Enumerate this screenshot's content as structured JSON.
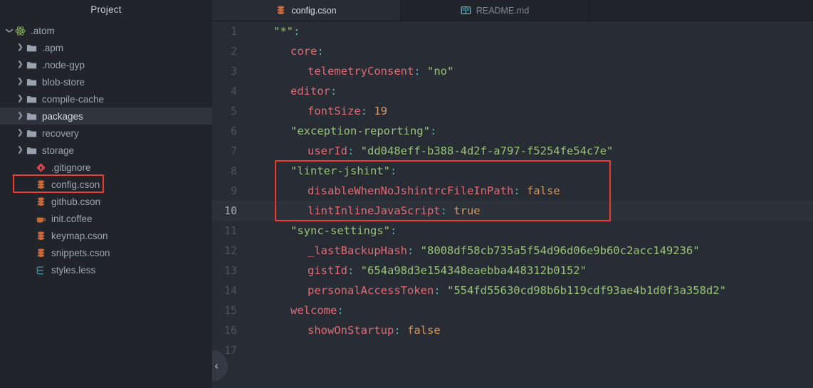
{
  "sidebar": {
    "title": "Project",
    "items": [
      {
        "label": ".atom",
        "icon": "atom-logo-icon",
        "depth": 0,
        "twisty": "open",
        "selected": false,
        "annotated": false
      },
      {
        "label": ".apm",
        "icon": "folder-icon",
        "depth": 1,
        "twisty": "closed",
        "selected": false,
        "annotated": false
      },
      {
        "label": ".node-gyp",
        "icon": "folder-icon",
        "depth": 1,
        "twisty": "closed",
        "selected": false,
        "annotated": false
      },
      {
        "label": "blob-store",
        "icon": "folder-icon",
        "depth": 1,
        "twisty": "closed",
        "selected": false,
        "annotated": false
      },
      {
        "label": "compile-cache",
        "icon": "folder-icon",
        "depth": 1,
        "twisty": "closed",
        "selected": false,
        "annotated": false
      },
      {
        "label": "packages",
        "icon": "folder-icon",
        "depth": 1,
        "twisty": "closed",
        "selected": true,
        "annotated": false
      },
      {
        "label": "recovery",
        "icon": "folder-icon",
        "depth": 1,
        "twisty": "closed",
        "selected": false,
        "annotated": false
      },
      {
        "label": "storage",
        "icon": "folder-icon",
        "depth": 1,
        "twisty": "closed",
        "selected": false,
        "annotated": false
      },
      {
        "label": ".gitignore",
        "icon": "git-diamond-icon",
        "depth": 2,
        "twisty": "none",
        "selected": false,
        "annotated": false
      },
      {
        "label": "config.cson",
        "icon": "database-icon",
        "depth": 2,
        "twisty": "none",
        "selected": false,
        "annotated": true
      },
      {
        "label": "github.cson",
        "icon": "database-icon",
        "depth": 2,
        "twisty": "none",
        "selected": false,
        "annotated": false
      },
      {
        "label": "init.coffee",
        "icon": "coffee-cup-icon",
        "depth": 2,
        "twisty": "none",
        "selected": false,
        "annotated": false
      },
      {
        "label": "keymap.cson",
        "icon": "database-icon",
        "depth": 2,
        "twisty": "none",
        "selected": false,
        "annotated": false
      },
      {
        "label": "snippets.cson",
        "icon": "database-icon",
        "depth": 2,
        "twisty": "none",
        "selected": false,
        "annotated": false
      },
      {
        "label": "styles.less",
        "icon": "less-file-icon",
        "depth": 2,
        "twisty": "none",
        "selected": false,
        "annotated": false
      }
    ]
  },
  "tabs": [
    {
      "label": "config.cson",
      "icon": "database-icon",
      "active": true
    },
    {
      "label": "README.md",
      "icon": "book-icon",
      "active": false
    }
  ],
  "editor": {
    "filename": "config.cson",
    "cursor_line": 10,
    "lines": [
      {
        "num": "1",
        "indent": 0,
        "tokens": [
          {
            "t": "\"*\"",
            "c": "s"
          },
          {
            "t": ":",
            "c": "p"
          }
        ]
      },
      {
        "num": "2",
        "indent": 1,
        "tokens": [
          {
            "t": "core",
            "c": "k"
          },
          {
            "t": ":",
            "c": "p"
          }
        ]
      },
      {
        "num": "3",
        "indent": 2,
        "tokens": [
          {
            "t": "telemetryConsent",
            "c": "k"
          },
          {
            "t": ": ",
            "c": "p"
          },
          {
            "t": "\"no\"",
            "c": "s"
          }
        ]
      },
      {
        "num": "4",
        "indent": 1,
        "tokens": [
          {
            "t": "editor",
            "c": "k"
          },
          {
            "t": ":",
            "c": "p"
          }
        ]
      },
      {
        "num": "5",
        "indent": 2,
        "tokens": [
          {
            "t": "fontSize",
            "c": "k"
          },
          {
            "t": ": ",
            "c": "p"
          },
          {
            "t": "19",
            "c": "n"
          }
        ]
      },
      {
        "num": "6",
        "indent": 1,
        "tokens": [
          {
            "t": "\"exception-reporting\"",
            "c": "s"
          },
          {
            "t": ":",
            "c": "p"
          }
        ]
      },
      {
        "num": "7",
        "indent": 2,
        "tokens": [
          {
            "t": "userId",
            "c": "k"
          },
          {
            "t": ": ",
            "c": "p"
          },
          {
            "t": "\"dd048eff-b388-4d2f-a797-f5254fe54c7e\"",
            "c": "s"
          }
        ]
      },
      {
        "num": "8",
        "indent": 1,
        "tokens": [
          {
            "t": "\"linter-jshint\"",
            "c": "s"
          },
          {
            "t": ":",
            "c": "p"
          }
        ]
      },
      {
        "num": "9",
        "indent": 2,
        "tokens": [
          {
            "t": "disableWhenNoJshintrcFileInPath",
            "c": "k"
          },
          {
            "t": ": ",
            "c": "p"
          },
          {
            "t": "false",
            "c": "n"
          }
        ]
      },
      {
        "num": "10",
        "indent": 2,
        "tokens": [
          {
            "t": "lintInlineJavaScript",
            "c": "k"
          },
          {
            "t": ": ",
            "c": "p"
          },
          {
            "t": "true",
            "c": "n"
          }
        ]
      },
      {
        "num": "11",
        "indent": 1,
        "tokens": [
          {
            "t": "\"sync-settings\"",
            "c": "s"
          },
          {
            "t": ":",
            "c": "p"
          }
        ]
      },
      {
        "num": "12",
        "indent": 2,
        "tokens": [
          {
            "t": "_lastBackupHash",
            "c": "k"
          },
          {
            "t": ": ",
            "c": "p"
          },
          {
            "t": "\"8008df58cb735a5f54d96d06e9b60c2acc149236\"",
            "c": "s"
          }
        ]
      },
      {
        "num": "13",
        "indent": 2,
        "tokens": [
          {
            "t": "gistId",
            "c": "k"
          },
          {
            "t": ": ",
            "c": "p"
          },
          {
            "t": "\"654a98d3e154348eaebba448312b0152\"",
            "c": "s"
          }
        ]
      },
      {
        "num": "14",
        "indent": 2,
        "tokens": [
          {
            "t": "personalAccessToken",
            "c": "k"
          },
          {
            "t": ": ",
            "c": "p"
          },
          {
            "t": "\"554fd55630cd98b6b119cdf93ae4b1d0f3a358d2\"",
            "c": "s"
          }
        ]
      },
      {
        "num": "15",
        "indent": 1,
        "tokens": [
          {
            "t": "welcome",
            "c": "k"
          },
          {
            "t": ":",
            "c": "p"
          }
        ]
      },
      {
        "num": "16",
        "indent": 2,
        "tokens": [
          {
            "t": "showOnStartup",
            "c": "k"
          },
          {
            "t": ": ",
            "c": "p"
          },
          {
            "t": "false",
            "c": "n"
          }
        ]
      },
      {
        "num": "17",
        "indent": 0,
        "tokens": []
      }
    ]
  },
  "annotations": {
    "color": "#ee3b30",
    "editor_box": {
      "label": "linter-jshint-highlight-box",
      "lines": "8-10"
    },
    "sidebar_box": {
      "label": "config-cson-highlight-box",
      "target": "config.cson"
    }
  },
  "controls": {
    "collapse_handle": {
      "label": "collapse-panel-handle",
      "glyph": "‹"
    }
  }
}
